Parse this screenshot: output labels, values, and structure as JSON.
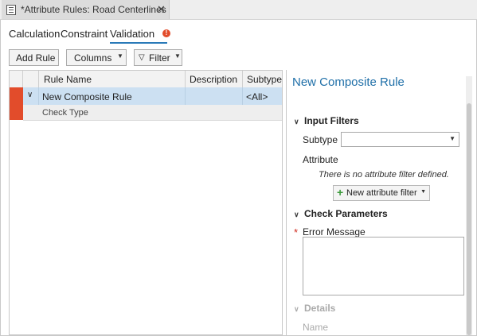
{
  "window": {
    "tab_title": "*Attribute Rules: Road Centerlines",
    "close_glyph": "✕"
  },
  "subtabs": [
    {
      "label": "Calculation"
    },
    {
      "label": "Constraint"
    },
    {
      "label": "Validation",
      "active": true,
      "error_badge": "!"
    }
  ],
  "toolbar": {
    "add_rule_label": "Add Rule",
    "columns_label": "Columns",
    "filter_label": "Filter"
  },
  "grid": {
    "columns": [
      "Rule Name",
      "Description",
      "Subtype"
    ],
    "rows": [
      {
        "rule_name": "New Composite Rule",
        "description": "",
        "subtype": "<All>",
        "error": true
      }
    ],
    "subrow_label": "Check Type"
  },
  "panel": {
    "title": "New Composite Rule",
    "input_filters": {
      "heading": "Input Filters",
      "subtype_label": "Subtype",
      "subtype_value": "",
      "attribute_label": "Attribute",
      "no_filter_note": "There is no attribute filter defined.",
      "add_filter_label": "New attribute filter"
    },
    "check_parameters": {
      "heading": "Check Parameters",
      "error_message_label": "Error Message",
      "required_marker": "*"
    },
    "details": {
      "heading": "Details",
      "name_label": "Name"
    }
  },
  "colors": {
    "accent": "#2a7ab8",
    "error": "#e24c2b",
    "selection": "#cce0f2",
    "title": "#1f6fa8"
  }
}
